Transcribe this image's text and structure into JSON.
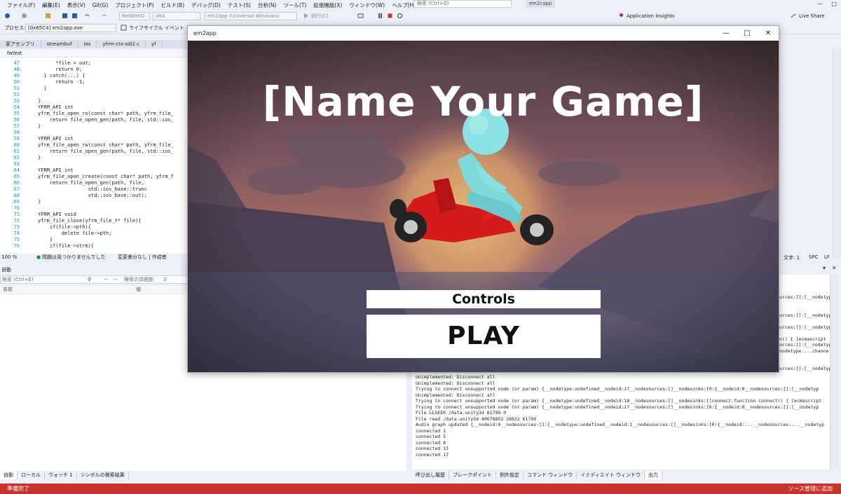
{
  "menu": [
    "ファイル(F)",
    "編集(E)",
    "表示(V)",
    "Git(G)",
    "プロジェクト(P)",
    "ビルド(B)",
    "デバッグ(D)",
    "テスト(S)",
    "分析(N)",
    "ツール(T)",
    "拡張機能(X)",
    "ウィンドウ(W)",
    "ヘルプ(H)"
  ],
  "search_placeholder": "検索 (Ctrl+Q)",
  "project_badge": "em2capp",
  "toolbar": {
    "config": "RelWithD",
    "platform": "x64",
    "startup": "em2app (Universal Windows)",
    "continue": "続行(C)",
    "insights": "Application Insights",
    "live_share": "Live Share"
  },
  "toolbar2": {
    "process_label": "プロセス:",
    "process_value": "[0x65C4] em2app.exe",
    "lifecycle": "ライフサイクル イベント"
  },
  "doc_tabs": [
    "家アセンブリ",
    "streambuf",
    "ios",
    "yfrm-ctx-sdl2.c",
    "yf"
  ],
  "file_label": "fwtest",
  "code_lines": [
    {
      "n": "47",
      "t": "      *file = out;"
    },
    {
      "n": "48",
      "t": "      return 0;"
    },
    {
      "n": "49",
      "t": "  } catch(...) {"
    },
    {
      "n": "50",
      "t": "      return -1;"
    },
    {
      "n": "51",
      "t": "  }"
    },
    {
      "n": "52",
      "t": ""
    },
    {
      "n": "53",
      "t": "}"
    },
    {
      "n": "54",
      "t": "YFRM_API int"
    },
    {
      "n": "55",
      "t": "yfrm_file_open_ro(const char* path, yfrm_file_"
    },
    {
      "n": "56",
      "t": "    return file_open_gen(path, file, std::ios_"
    },
    {
      "n": "57",
      "t": "}"
    },
    {
      "n": "58",
      "t": ""
    },
    {
      "n": "59",
      "t": "YFRM_API int"
    },
    {
      "n": "60",
      "t": "yfrm_file_open_rw(const char* path, yfrm_file_"
    },
    {
      "n": "61",
      "t": "    return file_open_gen(path, file, std::ios_"
    },
    {
      "n": "62",
      "t": "}"
    },
    {
      "n": "63",
      "t": ""
    },
    {
      "n": "64",
      "t": "YFRM_API int"
    },
    {
      "n": "65",
      "t": "yfrm_file_open_create(const char* path, yfrm_f"
    },
    {
      "n": "66",
      "t": "    return file_open_gen(path, file,"
    },
    {
      "n": "67",
      "t": "                 std::ios_base::trunc"
    },
    {
      "n": "68",
      "t": "                 std::ios_base::out);"
    },
    {
      "n": "69",
      "t": "}"
    },
    {
      "n": "70",
      "t": ""
    },
    {
      "n": "71",
      "t": "YFRM_API void"
    },
    {
      "n": "72",
      "t": "yfrm_file_close(yfrm_file_t* file){"
    },
    {
      "n": "73",
      "t": "    if(file->pth){"
    },
    {
      "n": "74",
      "t": "        delete file->pth;"
    },
    {
      "n": "75",
      "t": "    }"
    },
    {
      "n": "76",
      "t": "    if(file->strm){"
    }
  ],
  "editor_status": {
    "zoom": "100 %",
    "issues": "問題は見つかりませんでした",
    "changes": "変更差分なし | 作成者"
  },
  "editor_right_status": {
    "col": "文字: 1",
    "spc": "SPC",
    "lf": "LF"
  },
  "auto_window": {
    "title": "自動",
    "search_placeholder": "検索 (Ctrl+E)",
    "depth_label": "検索の詳細度:",
    "depth_value": "3",
    "col_name": "名前",
    "col_value": "値"
  },
  "bottom_tabs_left": [
    "自動",
    "ローカル",
    "ウォッチ 1",
    "シンボルの検索結果"
  ],
  "bottom_tabs_right": [
    "呼び出し履歴",
    "ブレークポイント",
    "例外設定",
    "コマンド ウィンドウ",
    "イミディエイト ウィンドウ",
    "出力"
  ],
  "output_side_lines": [
    "urces:[]:[__nodetyp",
    "",
    "",
    "urces:[]:[__nodetyp",
    "",
    "urces:[]:[__nodetyp",
    "",
    "n() { [ecmascript",
    "urces:[]:[__nodetyp",
    "nodetype:...channe",
    "",
    "",
    "urces:[]:[__nodetyp",
    "",
    "urces:[]:[__nodetyp"
  ],
  "output_lines": [
    "Unimplemented: Disconnect all",
    "Unimplemented: Disconnect all",
    "Trying to connect unsupported node (or param) {__nodetype:undefined__nodeid:17__nodesources:[]__nodesinks:[0:{__nodeid:0__nodesources:[]:[__nodetyp",
    "Unimplemented: Disconnect all",
    "Trying to connect unsupported node (or param) {__nodetype:undefined__nodeid:18__nodesources:[]__nodesinks:[]connect:function connect() { [ecmascript",
    "Trying to connect unsupported node (or param) {__nodetype:undefined__nodeid:17__nodesources:[]__nodesinks:[0:{__nodeid:0__nodesources:[]:[__nodetyp",
    "File LLSEEK /data.unity3d 61799 0",
    "File read /data.unity3d 40678852 28622 61799",
    "Audio graph updated {__nodeid:0__nodesources:[1:{__nodetype:undefined__nodeid:1__nodesources:[]__nodesinks:[0:{__nodeid:...__nodesources:...__nodetyp",
    "connected 1",
    "connected 5",
    "connected 8",
    "connected 13",
    "connected 17"
  ],
  "status_bar": {
    "left": "準備完了",
    "right": "ソース管理に追加"
  },
  "game_window": {
    "title": "em2app",
    "heading": "[Name Your Game]",
    "controls_label": "Controls",
    "play_label": "PLAY"
  },
  "colors": {
    "status_red": "#c6342d",
    "code_linenum": "#2b91af",
    "keyword": "#0000ff",
    "game_sky_top": "#5a4448",
    "kart_red": "#e01818",
    "character_cyan": "#6fd6d8"
  }
}
